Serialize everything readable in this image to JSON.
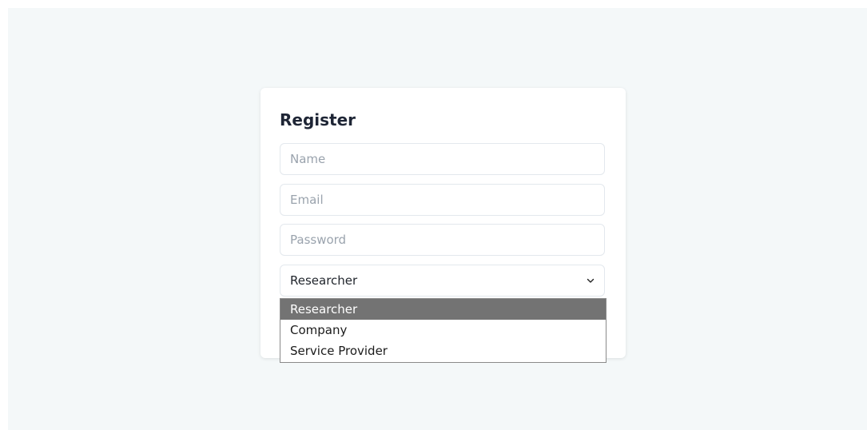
{
  "form": {
    "title": "Register",
    "name_placeholder": "Name",
    "email_placeholder": "Email",
    "password_placeholder": "Password",
    "role_selected": "Researcher"
  },
  "dropdown": {
    "options": [
      "Researcher",
      "Company",
      "Service Provider"
    ],
    "highlighted": "Researcher"
  },
  "icons": {
    "select_arrow": "chevron-down-icon"
  },
  "colors": {
    "page_bg": "#f4f8f9",
    "card_bg": "#ffffff",
    "title": "#1e2535",
    "highlight_bg": "#737373"
  }
}
